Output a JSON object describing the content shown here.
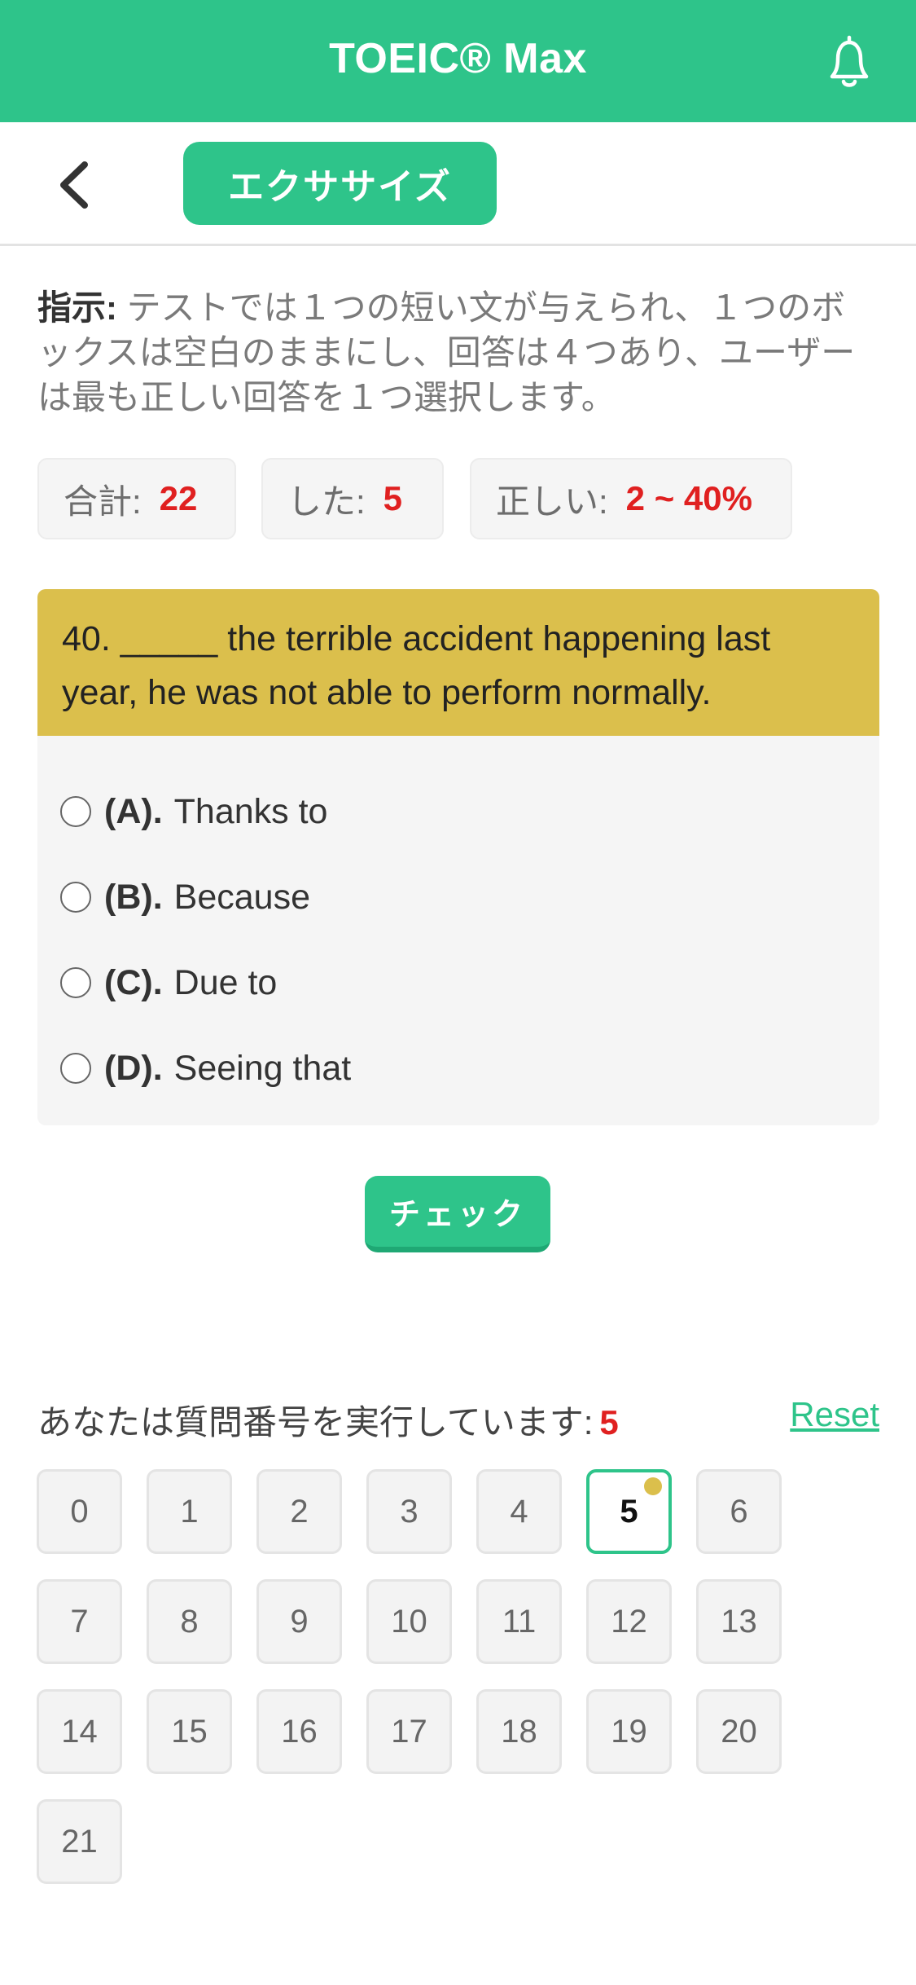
{
  "header": {
    "title": "TOEIC® Max",
    "icon": "bell-icon"
  },
  "subheader": {
    "back_icon": "chevron-left-icon",
    "tab_label": "エクササイズ"
  },
  "instructions": {
    "label": "指示:",
    "text": " テストでは１つの短い文が与えられ、１つのボックスは空白のままにし、回答は４つあり、ユーザーは最も正しい回答を１つ選択します。"
  },
  "stats": {
    "total_label": "合計:",
    "total_value": "22",
    "done_label": "した:",
    "done_value": "5",
    "correct_label": "正しい:",
    "correct_value": "2 ~ 40%"
  },
  "question": {
    "text": "40. _____ the terrible accident happening last year, he was not able to perform normally.",
    "options": [
      {
        "label": "(A).",
        "text": "Thanks to"
      },
      {
        "label": "(B).",
        "text": "Because"
      },
      {
        "label": "(C).",
        "text": "Due to"
      },
      {
        "label": "(D).",
        "text": "Seeing that"
      }
    ]
  },
  "check_label": "チェック",
  "progress": {
    "label": "あなたは質問番号を実行しています:",
    "current": "5",
    "reset_label": "Reset"
  },
  "question_numbers": [
    "0",
    "1",
    "2",
    "3",
    "4",
    "5",
    "6",
    "7",
    "8",
    "9",
    "10",
    "11",
    "12",
    "13",
    "14",
    "15",
    "16",
    "17",
    "18",
    "19",
    "20",
    "21"
  ],
  "active_question": "5",
  "colors": {
    "accent": "#2ec48a",
    "highlight": "#dbbf4c",
    "alert": "#e02020"
  }
}
